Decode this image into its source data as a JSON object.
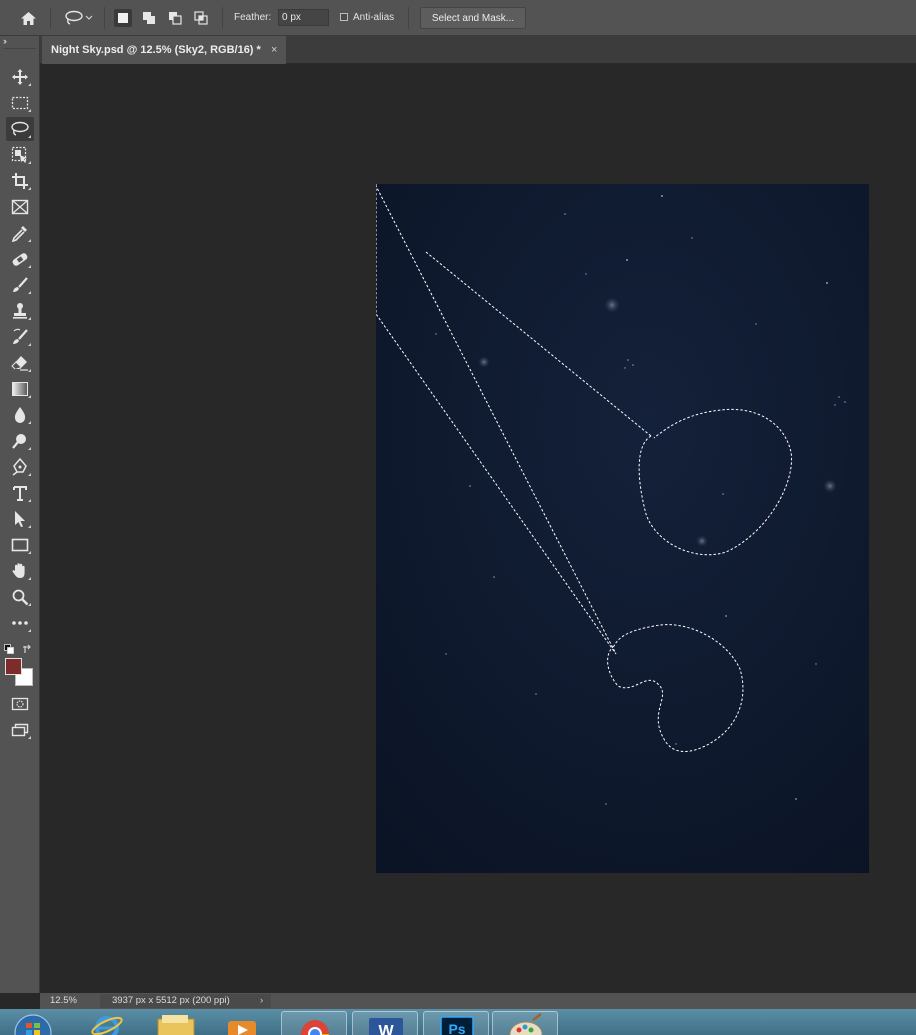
{
  "options_bar": {
    "home_icon": "home-icon",
    "tool_preset_icon": "lasso-icon",
    "selection_modes": [
      "new-selection-icon",
      "add-to-selection-icon",
      "subtract-from-selection-icon",
      "intersect-selection-icon"
    ],
    "feather_label": "Feather:",
    "feather_value": "0 px",
    "anti_alias_label": "Anti-alias",
    "anti_alias_checked": false,
    "select_mask_label": "Select and Mask..."
  },
  "document_tab": {
    "title": "Night Sky.psd @ 12.5% (Sky2, RGB/16) *",
    "close": "×"
  },
  "toolbar": {
    "collapse": "››",
    "tools": [
      {
        "name": "move-tool",
        "icon": "move-icon",
        "active": false
      },
      {
        "name": "rectangular-marquee-tool",
        "icon": "marquee-icon",
        "active": false
      },
      {
        "name": "lasso-tool",
        "icon": "lasso-icon",
        "active": true
      },
      {
        "name": "object-selection-tool",
        "icon": "object-selection-icon",
        "active": false
      },
      {
        "name": "crop-tool",
        "icon": "crop-icon",
        "active": false
      },
      {
        "name": "frame-tool",
        "icon": "frame-icon",
        "active": false
      },
      {
        "name": "eyedropper-tool",
        "icon": "eyedropper-icon",
        "active": false
      },
      {
        "name": "healing-brush-tool",
        "icon": "bandage-icon",
        "active": false
      },
      {
        "name": "brush-tool",
        "icon": "brush-icon",
        "active": false
      },
      {
        "name": "clone-stamp-tool",
        "icon": "stamp-icon",
        "active": false
      },
      {
        "name": "history-brush-tool",
        "icon": "history-brush-icon",
        "active": false
      },
      {
        "name": "eraser-tool",
        "icon": "eraser-icon",
        "active": false
      },
      {
        "name": "gradient-tool",
        "icon": "gradient-icon",
        "active": false
      },
      {
        "name": "blur-tool",
        "icon": "drop-icon",
        "active": false
      },
      {
        "name": "dodge-tool",
        "icon": "dodge-icon",
        "active": false
      },
      {
        "name": "pen-tool",
        "icon": "pen-icon",
        "active": false
      },
      {
        "name": "type-tool",
        "icon": "type-icon",
        "active": false
      },
      {
        "name": "path-selection-tool",
        "icon": "arrow-icon",
        "active": false
      },
      {
        "name": "rectangle-tool",
        "icon": "rectangle-icon",
        "active": false
      },
      {
        "name": "hand-tool",
        "icon": "hand-icon",
        "active": false
      },
      {
        "name": "zoom-tool",
        "icon": "zoom-icon",
        "active": false
      },
      {
        "name": "edit-toolbar",
        "icon": "more-icon",
        "active": false
      }
    ],
    "foreground_color": "#7e2b2b",
    "background_color": "#ffffff"
  },
  "status_bar": {
    "zoom": "12.5%",
    "doc_info": "3937 px x 5512 px (200 ppi)",
    "arrow": "›"
  },
  "colors": {
    "app_panel": "#535353",
    "workspace": "#282828",
    "canvas_sky": "#0c1628",
    "selection_marquee": "#ffffff"
  },
  "taskbar": {
    "apps": [
      "windows-start-icon",
      "internet-explorer-icon",
      "file-explorer-icon",
      "media-player-icon",
      "chrome-icon",
      "word-icon",
      "photoshop-icon",
      "paint-icon"
    ],
    "photoshop_label": "Ps",
    "word_label": "W"
  }
}
